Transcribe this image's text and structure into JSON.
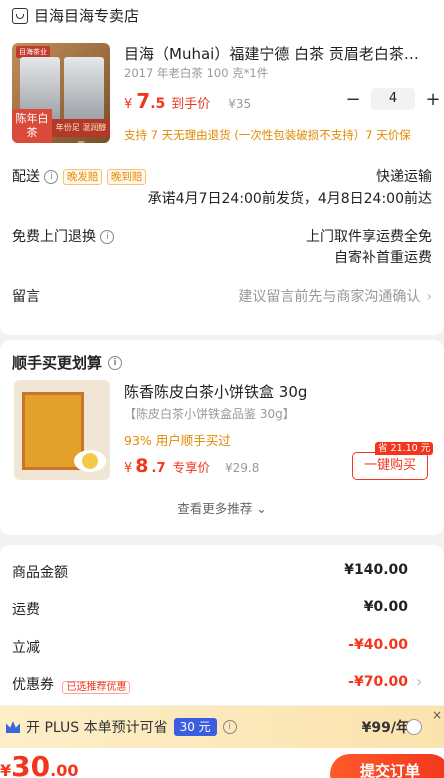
{
  "store": {
    "name": "目海目海专卖店",
    "icon": "store-icon"
  },
  "product": {
    "title": "目海（Muhai）福建宁德 白茶 贡眉老白茶散装…",
    "spec": "2017 年老白茶 100 克*1件",
    "currency": "¥",
    "price_int": "7",
    "price_dec": ".5",
    "price_label": "到手价",
    "orig_price": "¥35",
    "quantity": "4",
    "minus": "−",
    "plus": "+",
    "policy": "支持 7 天无理由退货 (一次性包装破损不支持）7 天价保",
    "image_text": {
      "brand": "目海茶业",
      "tag": "陈年白茶",
      "band": "年份足 温润醇厚"
    }
  },
  "delivery": {
    "label": "配送",
    "tags": [
      "晚发赔",
      "晚到赔"
    ],
    "method": "快递运输",
    "promise": "承诺4月7日24:00前发货，4月8日24:00前达"
  },
  "returns": {
    "label": "免费上门退换",
    "line1": "上门取件享运费全免",
    "line2": "自寄补首重运费"
  },
  "message": {
    "label": "留言",
    "placeholder": "建议留言前先与商家沟通确认"
  },
  "recommend": {
    "heading": "顺手买更划算",
    "title": "陈香陈皮白茶小饼铁盒 30g",
    "subtitle": "【陈皮白茶小饼铁盒品鉴 30g】",
    "buyers": "93% 用户顺手买过",
    "currency": "¥",
    "price_int": "8",
    "price_dec": ".7",
    "price_label": "专享价",
    "orig_price": "¥29.8",
    "save_tag": "省 21.10 元",
    "buy_button": "一键购买",
    "more": "查看更多推荐"
  },
  "summary": {
    "rows": [
      {
        "label": "商品金额",
        "value": "¥140.00"
      },
      {
        "label": "运费",
        "value": "¥0.00"
      },
      {
        "label": "立减",
        "value": "-¥40.00"
      },
      {
        "label": "优惠券",
        "tag": "已选推荐优惠",
        "value": "-¥70.00"
      }
    ]
  },
  "plus_bar": {
    "text": "开 PLUS 本单预计可省",
    "amount": "30 元",
    "price": "¥99/年",
    "close": "×"
  },
  "footer": {
    "total_currency": "¥",
    "total_int": "30",
    "total_dec": ".00",
    "submit": "提交订单"
  },
  "colors": {
    "accent": "#f2361d",
    "warning": "#e08a00",
    "plus_blue": "#3b5ee0"
  }
}
